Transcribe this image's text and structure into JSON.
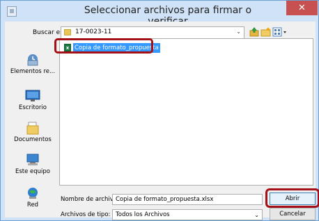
{
  "window": {
    "title": "Seleccionar archivos para firmar o verificar",
    "close_label": "✕"
  },
  "toolbar": {
    "lookin_label": "Buscar en:",
    "lookin_value": "17-0023-11",
    "icons": [
      "up-folder-icon",
      "new-folder-icon",
      "view-menu-icon"
    ]
  },
  "sidebar": {
    "items": [
      {
        "label": "Elementos re...",
        "icon": "recent-items-icon"
      },
      {
        "label": "Escritorio",
        "icon": "desktop-icon"
      },
      {
        "label": "Documentos",
        "icon": "documents-icon"
      },
      {
        "label": "Este equipo",
        "icon": "computer-icon"
      },
      {
        "label": "Red",
        "icon": "network-icon"
      }
    ]
  },
  "files": [
    {
      "name": "Copia de formato_propuesta",
      "icon": "excel-file-icon",
      "selected": true
    }
  ],
  "form": {
    "filename_label": "Nombre de archivo:",
    "filename_value": "Copia de formato_propuesta.xlsx",
    "filetype_label": "Archivos de tipo:",
    "filetype_value": "Todos los Archivos"
  },
  "buttons": {
    "open": "Abrir",
    "cancel": "Cancelar"
  },
  "colors": {
    "highlight_annotation": "#a50f16",
    "selection": "#3399ff",
    "close_button": "#c75050"
  }
}
